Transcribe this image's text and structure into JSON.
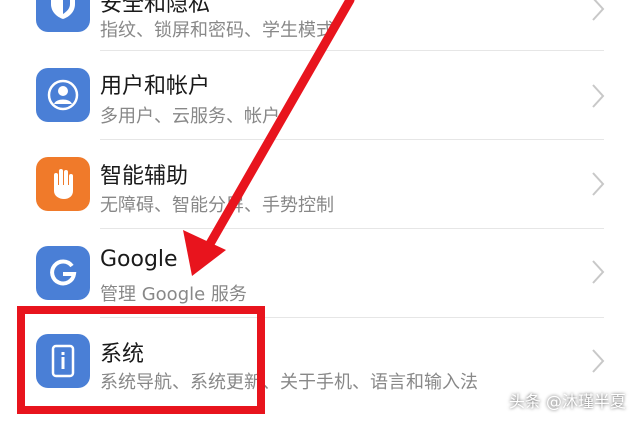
{
  "colors": {
    "security_icon": "#4a7fd6",
    "users_icon": "#4a7fd6",
    "assist_icon": "#f07a2a",
    "google_icon": "#4a7fd6",
    "system_icon": "#4a7fd6",
    "annotation_red": "#e8141d"
  },
  "settings": {
    "items": [
      {
        "title": "安全和隐私",
        "subtitle": "指纹、锁屏和密码、学生模式",
        "icon": "shield-icon"
      },
      {
        "title": "用户和帐户",
        "subtitle": "多用户、云服务、帐户",
        "icon": "user-icon"
      },
      {
        "title": "智能辅助",
        "subtitle": "无障碍、智能分屏、手势控制",
        "icon": "hand-icon"
      },
      {
        "title": "Google",
        "subtitle": "管理 Google 服务",
        "icon": "google-icon"
      },
      {
        "title": "系统",
        "subtitle": "系统导航、系统更新、关于手机、语言和输入法",
        "icon": "phone-info-icon"
      }
    ]
  },
  "watermark": "头条 @沐瑾半夏"
}
